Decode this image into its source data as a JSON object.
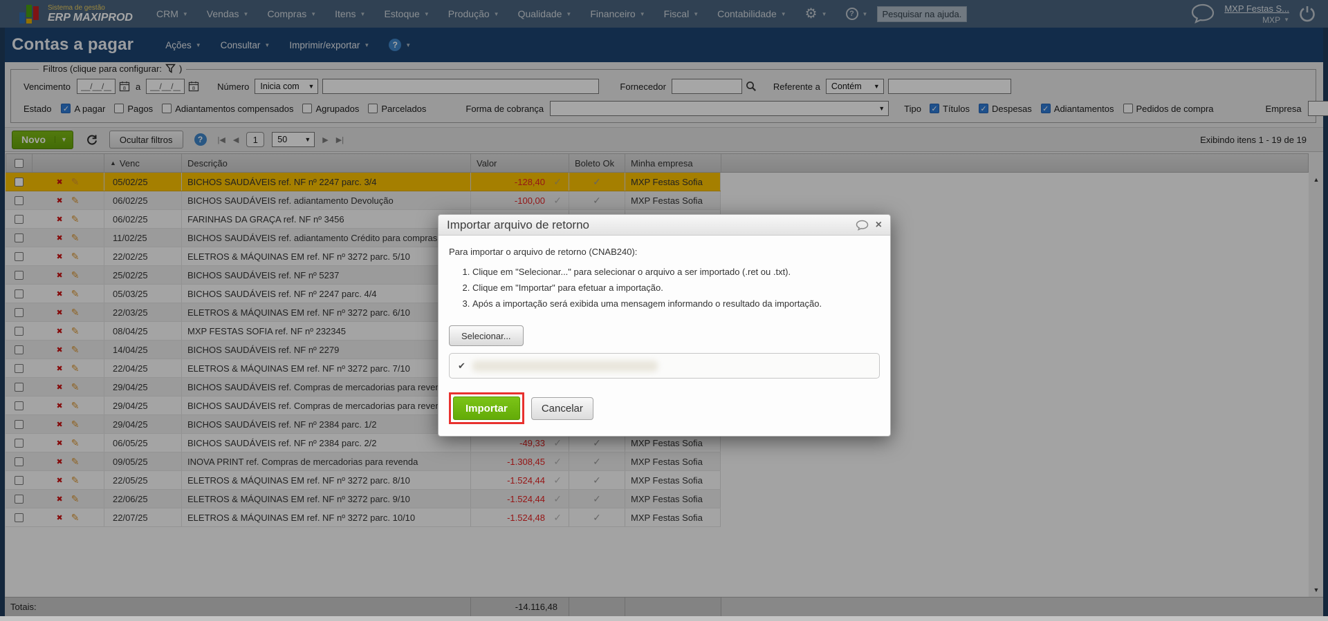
{
  "topbar": {
    "logo_line1": "Sistema de gestão",
    "logo_line2": "ERP MAXIPROD",
    "menus": [
      "CRM",
      "Vendas",
      "Compras",
      "Itens",
      "Estoque",
      "Produção",
      "Qualidade",
      "Financeiro",
      "Fiscal",
      "Contabilidade"
    ],
    "search_placeholder": "Pesquisar na ajuda...",
    "account": "MXP Festas S...",
    "company": "MXP"
  },
  "page": {
    "title": "Contas a pagar",
    "menus": [
      "Ações",
      "Consultar",
      "Imprimir/exportar"
    ]
  },
  "filters": {
    "legend": "Filtros (clique para configurar:",
    "legend_close": ")",
    "vencimento_label": "Vencimento",
    "date_mask": "__/__/__",
    "a_label": "a",
    "numero_label": "Número",
    "numero_op": "Inicia com",
    "fornecedor_label": "Fornecedor",
    "referente_label": "Referente a",
    "referente_op": "Contém",
    "estado_label": "Estado",
    "estado_options": [
      {
        "label": "A pagar",
        "checked": true
      },
      {
        "label": "Pagos",
        "checked": false
      },
      {
        "label": "Adiantamentos compensados",
        "checked": false
      },
      {
        "label": "Agrupados",
        "checked": false
      },
      {
        "label": "Parcelados",
        "checked": false
      }
    ],
    "forma_label": "Forma de cobrança",
    "tipo_label": "Tipo",
    "tipo_options": [
      {
        "label": "Títulos",
        "checked": true
      },
      {
        "label": "Despesas",
        "checked": true
      },
      {
        "label": "Adiantamentos",
        "checked": true
      },
      {
        "label": "Pedidos de compra",
        "checked": false
      }
    ],
    "empresa_label": "Empresa"
  },
  "toolbar": {
    "new_label": "Novo",
    "hide_filters_label": "Ocultar filtros",
    "page": "1",
    "page_size": "50",
    "showing": "Exibindo itens 1 - 19 de 19"
  },
  "table": {
    "headers": {
      "venc": "Venc",
      "descricao": "Descrição",
      "valor": "Valor",
      "boleto": "Boleto Ok",
      "empresa": "Minha empresa"
    },
    "rows": [
      {
        "venc": "05/02/25",
        "descricao": "BICHOS SAUDÁVEIS ref. NF nº 2247 parc. 3/4",
        "valor": "-128,40",
        "boleto": true,
        "empresa": "MXP Festas Sofia",
        "selected": true
      },
      {
        "venc": "06/02/25",
        "descricao": "BICHOS SAUDÁVEIS ref. adiantamento Devolução",
        "valor": "-100,00",
        "boleto": true,
        "empresa": "MXP Festas Sofia"
      },
      {
        "venc": "06/02/25",
        "descricao": "FARINHAS DA GRAÇA ref. NF nº 3456",
        "valor": "",
        "boleto": false,
        "empresa": ""
      },
      {
        "venc": "11/02/25",
        "descricao": "BICHOS SAUDÁVEIS ref. adiantamento Crédito para compras fut",
        "valor": "",
        "boleto": false,
        "empresa": ""
      },
      {
        "venc": "22/02/25",
        "descricao": "ELETROS & MÁQUINAS EM ref. NF nº 3272 parc. 5/10",
        "valor": "",
        "boleto": false,
        "empresa": ""
      },
      {
        "venc": "25/02/25",
        "descricao": "BICHOS SAUDÁVEIS ref. NF nº 5237",
        "valor": "",
        "boleto": false,
        "empresa": ""
      },
      {
        "venc": "05/03/25",
        "descricao": "BICHOS SAUDÁVEIS ref. NF nº 2247 parc. 4/4",
        "valor": "",
        "boleto": false,
        "empresa": ""
      },
      {
        "venc": "22/03/25",
        "descricao": "ELETROS & MÁQUINAS EM ref. NF nº 3272 parc. 6/10",
        "valor": "",
        "boleto": false,
        "empresa": ""
      },
      {
        "venc": "08/04/25",
        "descricao": "MXP FESTAS SOFIA ref. NF nº 232345",
        "valor": "",
        "boleto": false,
        "empresa": ""
      },
      {
        "venc": "14/04/25",
        "descricao": "BICHOS SAUDÁVEIS ref. NF nº 2279",
        "valor": "",
        "boleto": false,
        "empresa": ""
      },
      {
        "venc": "22/04/25",
        "descricao": "ELETROS & MÁQUINAS EM ref. NF nº 3272 parc. 7/10",
        "valor": "",
        "boleto": false,
        "empresa": ""
      },
      {
        "venc": "29/04/25",
        "descricao": "BICHOS SAUDÁVEIS ref. Compras de mercadorias para revenda",
        "valor": "",
        "boleto": false,
        "empresa": ""
      },
      {
        "venc": "29/04/25",
        "descricao": "BICHOS SAUDÁVEIS ref. Compras de mercadorias para revenda",
        "valor": "",
        "boleto": false,
        "empresa": ""
      },
      {
        "venc": "29/04/25",
        "descricao": "BICHOS SAUDÁVEIS ref. NF nº 2384 parc. 1/2",
        "valor": "",
        "boleto": false,
        "empresa": ""
      },
      {
        "venc": "06/05/25",
        "descricao": "BICHOS SAUDÁVEIS ref. NF nº 2384 parc. 2/2",
        "valor": "-49,33",
        "boleto": true,
        "empresa": "MXP Festas Sofia"
      },
      {
        "venc": "09/05/25",
        "descricao": "INOVA PRINT ref. Compras de mercadorias para revenda",
        "valor": "-1.308,45",
        "boleto": true,
        "empresa": "MXP Festas Sofia"
      },
      {
        "venc": "22/05/25",
        "descricao": "ELETROS & MÁQUINAS EM ref. NF nº 3272 parc. 8/10",
        "valor": "-1.524,44",
        "boleto": true,
        "empresa": "MXP Festas Sofia"
      },
      {
        "venc": "22/06/25",
        "descricao": "ELETROS & MÁQUINAS EM ref. NF nº 3272 parc. 9/10",
        "valor": "-1.524,44",
        "boleto": true,
        "empresa": "MXP Festas Sofia"
      },
      {
        "venc": "22/07/25",
        "descricao": "ELETROS & MÁQUINAS EM ref. NF nº 3272 parc. 10/10",
        "valor": "-1.524,48",
        "boleto": true,
        "empresa": "MXP Festas Sofia"
      }
    ],
    "totals_label": "Totais:",
    "totals_valor": "-14.116,48"
  },
  "modal": {
    "title": "Importar arquivo de retorno",
    "intro": "Para importar o arquivo de retorno (CNAB240):",
    "steps": [
      "Clique em \"Selecionar...\" para selecionar o arquivo a ser importado (.ret ou .txt).",
      "Clique em \"Importar\" para efetuar a importação.",
      "Após a importação será exibida uma mensagem informando o resultado da importação."
    ],
    "select_button": "Selecionar...",
    "import_button": "Importar",
    "cancel_button": "Cancelar"
  },
  "colors": {
    "accent_green": "#72b10d",
    "selected_row": "#fdc300",
    "negative_value": "#e62222",
    "annotation_red": "#e8312e",
    "topbar_blue": "#4a6580",
    "titlebar_blue": "#1d4472"
  }
}
